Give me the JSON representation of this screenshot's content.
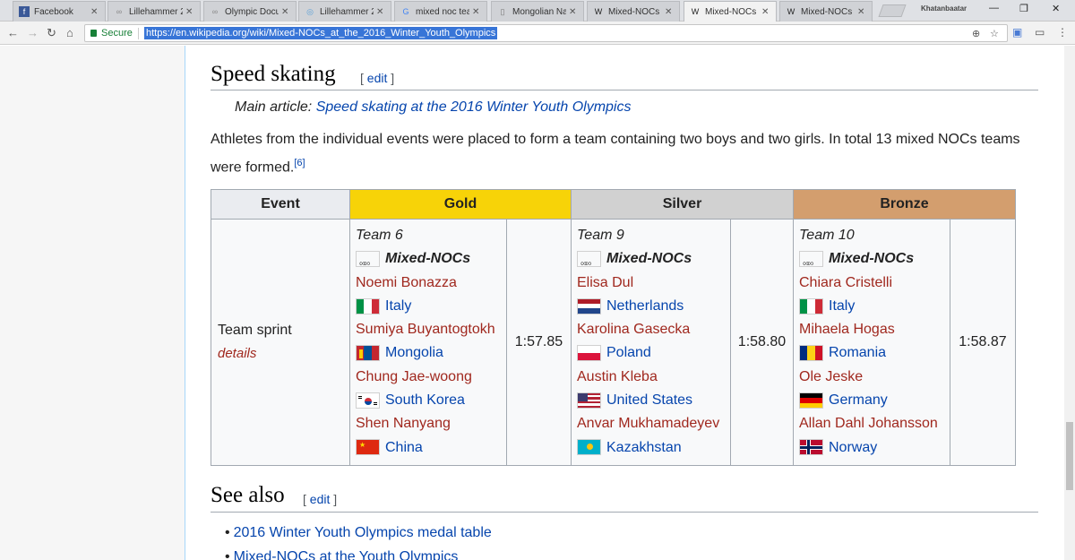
{
  "browser": {
    "tabs": [
      {
        "title": "Facebook",
        "icon": "facebook-icon",
        "fav_text": "f",
        "fav_color": "#3b5998",
        "active": false
      },
      {
        "title": "Lillehammer 2",
        "icon": "olympic-rings-icon",
        "fav_text": "∞",
        "fav_color": "#888",
        "active": false
      },
      {
        "title": "Olympic Docu",
        "icon": "olympic-rings-icon",
        "fav_text": "∞",
        "fav_color": "#888",
        "active": false
      },
      {
        "title": "Lillehammer 2",
        "icon": "lillehammer-logo-icon",
        "fav_text": "◎",
        "fav_color": "#5aa0d8",
        "active": false
      },
      {
        "title": "mixed noc tea",
        "icon": "google-icon",
        "fav_text": "G",
        "fav_color": "#4285f4",
        "active": false
      },
      {
        "title": "Mongolian Na",
        "icon": "page-icon",
        "fav_text": "▯",
        "fav_color": "#777",
        "active": false
      },
      {
        "title": "Mixed-NOCs a",
        "icon": "wikipedia-icon",
        "fav_text": "W",
        "fav_color": "#222",
        "active": false
      },
      {
        "title": "Mixed-NOCs a",
        "icon": "wikipedia-icon",
        "fav_text": "W",
        "fav_color": "#222",
        "active": true
      },
      {
        "title": "Mixed-NOCs p",
        "icon": "wikipedia-icon",
        "fav_text": "W",
        "fav_color": "#222",
        "active": false
      }
    ],
    "profile": "Khatanbaatar",
    "secure_label": "Secure",
    "url": "https://en.wikipedia.org/wiki/Mixed-NOCs_at_the_2016_Winter_Youth_Olympics"
  },
  "section": {
    "title": "Speed skating",
    "edit": "edit",
    "main_article_prefix": "Main article: ",
    "main_article_link": "Speed skating at the 2016 Winter Youth Olympics",
    "para_text": "Athletes from the individual events were placed to form a team containing two boys and two girls. In total 13 mixed NOCs teams were formed.",
    "para_ref": "[6]"
  },
  "table": {
    "headers": {
      "event": "Event",
      "gold": "Gold",
      "silver": "Silver",
      "bronze": "Bronze"
    },
    "event": "Team sprint",
    "details": "details",
    "noc_label": "Mixed-NOCs",
    "medals": [
      {
        "team": "Team 6",
        "time": "1:57.85",
        "members": [
          {
            "athlete": "Noemi Bonazza",
            "country": "Italy",
            "flag": "italy"
          },
          {
            "athlete": "Sumiya Buyantogtokh",
            "country": "Mongolia",
            "flag": "mongolia"
          },
          {
            "athlete": "Chung Jae-woong",
            "country": "South Korea",
            "flag": "south-korea"
          },
          {
            "athlete": "Shen Nanyang",
            "country": "China",
            "flag": "china"
          }
        ]
      },
      {
        "team": "Team 9",
        "time": "1:58.80",
        "members": [
          {
            "athlete": "Elisa Dul",
            "country": "Netherlands",
            "flag": "netherlands"
          },
          {
            "athlete": "Karolina Gasecka",
            "country": "Poland",
            "flag": "poland"
          },
          {
            "athlete": "Austin Kleba",
            "country": "United States",
            "flag": "united-states"
          },
          {
            "athlete": "Anvar Mukhamadeyev",
            "country": "Kazakhstan",
            "flag": "kazakhstan"
          }
        ]
      },
      {
        "team": "Team 10",
        "time": "1:58.87",
        "members": [
          {
            "athlete": "Chiara Cristelli",
            "country": "Italy",
            "flag": "italy"
          },
          {
            "athlete": "Mihaela Hogas",
            "country": "Romania",
            "flag": "romania"
          },
          {
            "athlete": "Ole Jeske",
            "country": "Germany",
            "flag": "germany"
          },
          {
            "athlete": "Allan Dahl Johansson",
            "country": "Norway",
            "flag": "norway"
          }
        ]
      }
    ]
  },
  "see_also": {
    "title": "See also",
    "edit": "edit",
    "items": [
      "2016 Winter Youth Olympics medal table",
      "Mixed-NOCs at the Youth Olympics"
    ]
  },
  "colors": {
    "gold": "#f7d308",
    "silver": "#d1d1d1",
    "bronze": "#d39e6e",
    "link": "#0645ad",
    "athlete_link": "#a0281e"
  }
}
